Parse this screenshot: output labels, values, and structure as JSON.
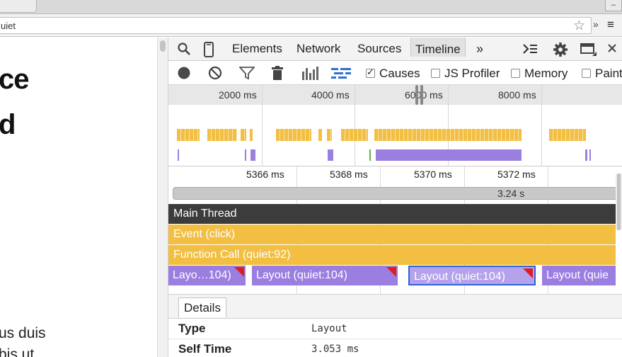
{
  "browser": {
    "url_fragment": "uiet",
    "star_glyph": "☆",
    "ext_glyph": "»",
    "menu_glyph": "≡",
    "window_button": "–"
  },
  "page": {
    "heading_line1": "ce",
    "heading_line2": "d",
    "text_line1": "us duis",
    "text_line2": "bis ut"
  },
  "devtools": {
    "tabs": [
      {
        "label": "Elements"
      },
      {
        "label": "Network"
      },
      {
        "label": "Sources"
      },
      {
        "label": "Timeline",
        "active": true
      }
    ],
    "more_tabs_glyph": "»",
    "icons": [
      "search-icon",
      "device-mode-icon",
      "console-drawer-icon",
      "settings-gear-icon",
      "dock-side-icon",
      "close-icon"
    ]
  },
  "timeline_toolbar": {
    "icons": [
      "record-icon",
      "clear-icon",
      "filter-icon",
      "trash-icon",
      "flamechart-toggle-icon",
      "waterfall-icon"
    ],
    "checkboxes": [
      {
        "label": "Causes",
        "checked": true
      },
      {
        "label": "JS Profiler",
        "checked": false
      },
      {
        "label": "Memory",
        "checked": false
      },
      {
        "label": "Paint",
        "checked": false
      }
    ]
  },
  "overview": {
    "ruler_labels": [
      "2000 ms",
      "4000 ms",
      "6000 ms",
      "8000 ms"
    ],
    "colors": {
      "scripting": "#f2bf43",
      "rendering": "#9a7ee0",
      "painting": "#59b34a"
    }
  },
  "flamechart": {
    "ruler_labels": [
      "5366 ms",
      "5368 ms",
      "5370 ms",
      "5372 ms"
    ],
    "selection_duration": "3.24 s",
    "rows": {
      "main_thread": "Main Thread",
      "event": "Event (click)",
      "function_call": "Function Call (quiet:92)"
    },
    "layouts": [
      {
        "label": "Layo…104)",
        "warning": true,
        "selected": false
      },
      {
        "label": "Layout (quiet:104)",
        "warning": true,
        "selected": false
      },
      {
        "label": "Layout (quiet:104)",
        "warning": true,
        "selected": true
      },
      {
        "label": "Layout (quie",
        "warning": false,
        "selected": false
      }
    ]
  },
  "details": {
    "tab_label": "Details",
    "rows": [
      {
        "key": "Type",
        "value": "Layout"
      },
      {
        "key": "Self Time",
        "value": "3.053 ms"
      }
    ]
  }
}
